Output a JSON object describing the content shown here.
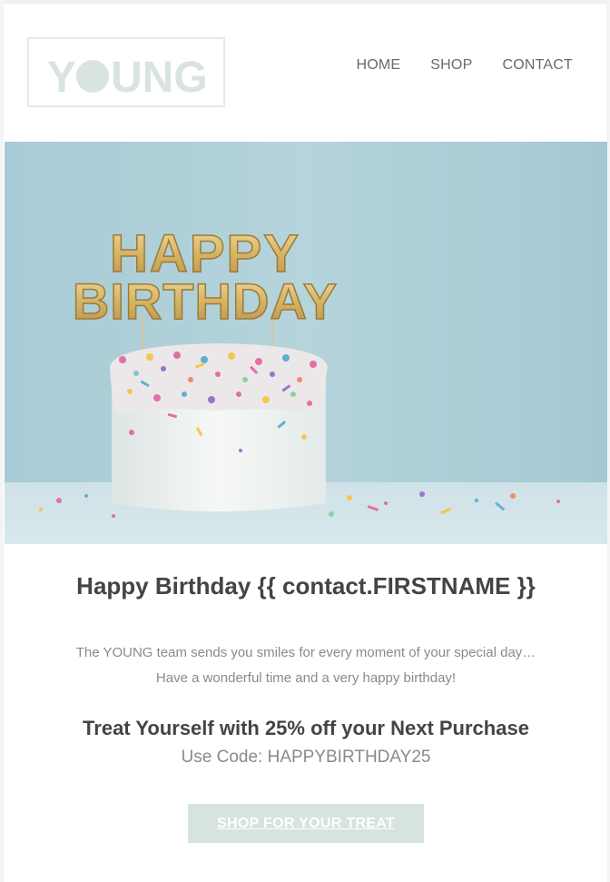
{
  "header": {
    "logo_text": "YOUNG",
    "nav": [
      "HOME",
      "SHOP",
      "CONTACT"
    ]
  },
  "hero": {
    "topper_line1": "HAPPY",
    "topper_line2": "BIRTHDAY"
  },
  "content": {
    "headline": "Happy Birthday {{ contact.FIRSTNAME }}",
    "message_line1": "The YOUNG team sends you smiles for every moment of your special day…",
    "message_line2": "Have a wonderful time and a very happy birthday!",
    "offer_title": "Treat Yourself with 25% off your Next Purchase",
    "code_text": "Use Code: HAPPYBIRTHDAY25",
    "cta_label": "SHOP FOR YOUR TREAT"
  },
  "colors": {
    "logo": "#d9e4e1",
    "cta_bg": "#d7e3e0",
    "hero_bg": "#a9ced8",
    "text_dark": "#444444",
    "text_muted": "#8a8a8a"
  }
}
